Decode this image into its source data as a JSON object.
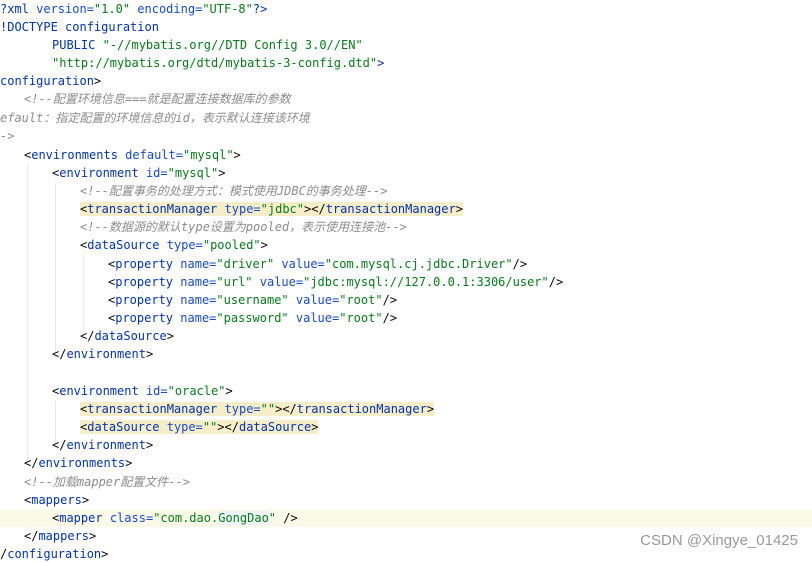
{
  "code": {
    "xml_decl": {
      "open": "?xml ",
      "attr1": "version=",
      "val1": "\"1.0\"",
      "sp": " ",
      "attr2": "encoding=",
      "val2": "\"UTF-8\"",
      "close": "?>"
    },
    "doctype": {
      "kw": "!DOCTYPE ",
      "name": "configuration"
    },
    "public": {
      "kw": "PUBLIC ",
      "id": "\"-//mybatis.org//DTD Config 3.0//EN\""
    },
    "dtd_url": "\"http://mybatis.org/dtd/mybatis-3-config.dtd\"",
    "dtd_end": ">",
    "config_open": {
      "tag": "configuration",
      "end": ">"
    },
    "comment1": "<!--配置环境信息===就是配置连接数据库的参数",
    "comment2": "efault：指定配置的环境信息的id，表示默认连接该环境",
    "comment3": "->",
    "envs_open": {
      "lt": "<",
      "tag": "environments",
      "attr": "default=",
      "val": "\"mysql\"",
      "gt": ">"
    },
    "env_mysql_open": {
      "lt": "<",
      "tag": "environment",
      "attr": "id=",
      "val": "\"mysql\"",
      "gt": ">"
    },
    "comment_tx": "<!--配置事务的处理方式：模式使用JDBC的事务处理-->",
    "tx_mysql": {
      "lt": "<",
      "tag": "transactionManager",
      "attr": "type=",
      "val": "\"jdbc\"",
      "mid": "></",
      "endtag": "transactionManager",
      "gt": ">"
    },
    "comment_ds": "<!--数据源的默认type设置为pooled，表示使用连接池-->",
    "ds_open": {
      "lt": "<",
      "tag": "dataSource",
      "attr": "type=",
      "val": "\"pooled\"",
      "gt": ">"
    },
    "properties": [
      {
        "lt": "<",
        "tag": "property",
        "a1": "name=",
        "v1": "\"driver\"",
        "a2": "value=",
        "v2": "\"com.mysql.cj.jdbc.Driver\"",
        "end": "/>"
      },
      {
        "lt": "<",
        "tag": "property",
        "a1": "name=",
        "v1": "\"url\"",
        "a2": "value=",
        "v2": "\"jdbc:mysql://127.0.0.1:3306/user\"",
        "end": "/>"
      },
      {
        "lt": "<",
        "tag": "property",
        "a1": "name=",
        "v1": "\"username\"",
        "a2": "value=",
        "v2": "\"root\"",
        "end": "/>"
      },
      {
        "lt": "<",
        "tag": "property",
        "a1": "name=",
        "v1": "\"password\"",
        "a2": "value=",
        "v2": "\"root\"",
        "end": "/>"
      }
    ],
    "ds_close": {
      "lt": "</",
      "tag": "dataSource",
      "gt": ">"
    },
    "env_close1": {
      "lt": "</",
      "tag": "environment",
      "gt": ">"
    },
    "env_oracle_open": {
      "lt": "<",
      "tag": "environment",
      "attr": "id=",
      "val": "\"oracle\"",
      "gt": ">"
    },
    "tx_oracle": {
      "lt": "<",
      "tag": "transactionManager",
      "attr": "type=",
      "val": "\"\"",
      "mid": "></",
      "endtag": "transactionManager",
      "gt": ">"
    },
    "ds_oracle": {
      "lt": "<",
      "tag": "dataSource",
      "attr": "type=",
      "val": "\"\"",
      "mid": "></",
      "endtag": "dataSource",
      "gt": ">"
    },
    "env_close2": {
      "lt": "</",
      "tag": "environment",
      "gt": ">"
    },
    "envs_close": {
      "lt": "</",
      "tag": "environments",
      "gt": ">"
    },
    "comment_mapper": "<!--加载mapper配置文件-->",
    "mappers_open": {
      "lt": "<",
      "tag": "mappers",
      "gt": ">"
    },
    "mapper": {
      "lt": "<",
      "tag": "mapper",
      "attr": "class=",
      "val_pre": "\"com.dao.",
      "val_cls": "GongDao",
      "val_post": "\"",
      "end": " />"
    },
    "mappers_close": {
      "lt": "</",
      "tag": "mappers",
      "gt": ">"
    },
    "config_close": {
      "lt": "/",
      "tag": "configuration",
      "gt": ">"
    }
  },
  "watermark": "CSDN @Xingye_01425"
}
